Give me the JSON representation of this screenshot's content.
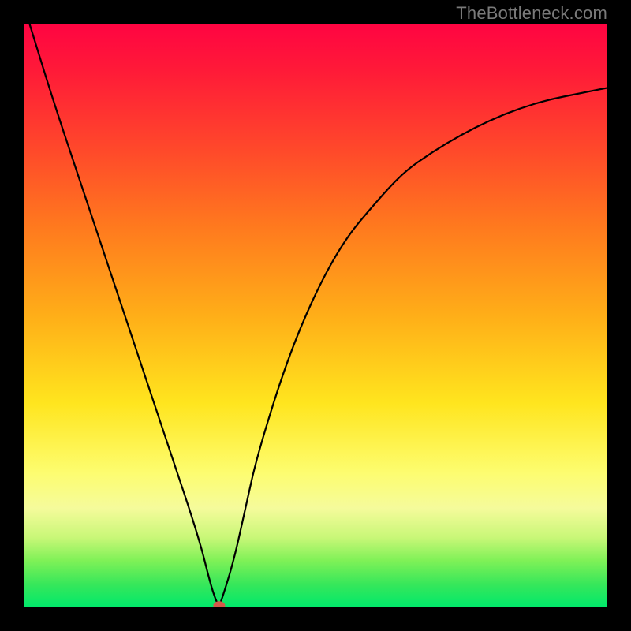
{
  "watermark": "TheBottleneck.com",
  "chart_data": {
    "type": "line",
    "title": "",
    "xlabel": "",
    "ylabel": "",
    "xlim": [
      0,
      100
    ],
    "ylim": [
      0,
      100
    ],
    "grid": false,
    "legend": false,
    "series": [
      {
        "name": "bottleneck-curve",
        "x": [
          1,
          5,
          10,
          15,
          20,
          25,
          30,
          32,
          33,
          33.5,
          34,
          36,
          38,
          40,
          45,
          50,
          55,
          60,
          65,
          70,
          75,
          80,
          85,
          90,
          95,
          100
        ],
        "values": [
          100,
          87,
          72,
          57,
          42,
          27,
          12,
          4,
          1,
          0.3,
          1.5,
          8,
          17,
          26,
          42,
          54,
          63,
          69,
          74.5,
          78,
          81,
          83.5,
          85.5,
          87,
          88,
          89
        ]
      }
    ],
    "marker": {
      "x": 33.5,
      "y": 0.3,
      "color": "#d45a4a"
    },
    "background_gradient": {
      "top_color": "#ff0442",
      "bottom_color": "#00e86b",
      "stops": [
        "#ff0442",
        "#ff7a1e",
        "#ffe51e",
        "#f5fb9b",
        "#38e75a",
        "#00e86b"
      ]
    }
  }
}
